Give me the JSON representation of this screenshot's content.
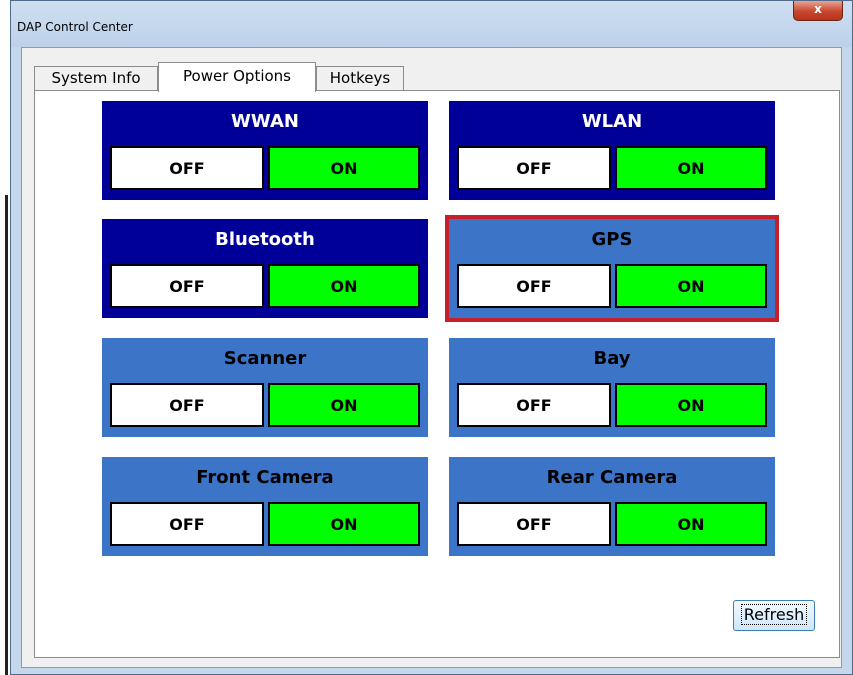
{
  "window": {
    "title": "DAP Control Center",
    "close_glyph": "x"
  },
  "tabs": [
    {
      "label": "System Info",
      "active": false
    },
    {
      "label": "Power Options",
      "active": true
    },
    {
      "label": "Hotkeys",
      "active": false
    }
  ],
  "groups": [
    {
      "title": "WWAN",
      "off_label": "OFF",
      "on_label": "ON",
      "style": "dark"
    },
    {
      "title": "WLAN",
      "off_label": "OFF",
      "on_label": "ON",
      "style": "dark"
    },
    {
      "title": "Bluetooth",
      "off_label": "OFF",
      "on_label": "ON",
      "style": "dark"
    },
    {
      "title": "GPS",
      "off_label": "OFF",
      "on_label": "ON",
      "style": "light",
      "selected": true
    },
    {
      "title": "Scanner",
      "off_label": "OFF",
      "on_label": "ON",
      "style": "light"
    },
    {
      "title": "Bay",
      "off_label": "OFF",
      "on_label": "ON",
      "style": "light"
    },
    {
      "title": "Front Camera",
      "off_label": "OFF",
      "on_label": "ON",
      "style": "light"
    },
    {
      "title": "Rear Camera",
      "off_label": "OFF",
      "on_label": "ON",
      "style": "light"
    }
  ],
  "refresh_label": "Refresh",
  "colors": {
    "dark_group": "#000099",
    "light_group": "#3c74c8",
    "on_switch": "#00ff00",
    "off_switch": "#ffffff",
    "selection_border": "#c8202b"
  }
}
